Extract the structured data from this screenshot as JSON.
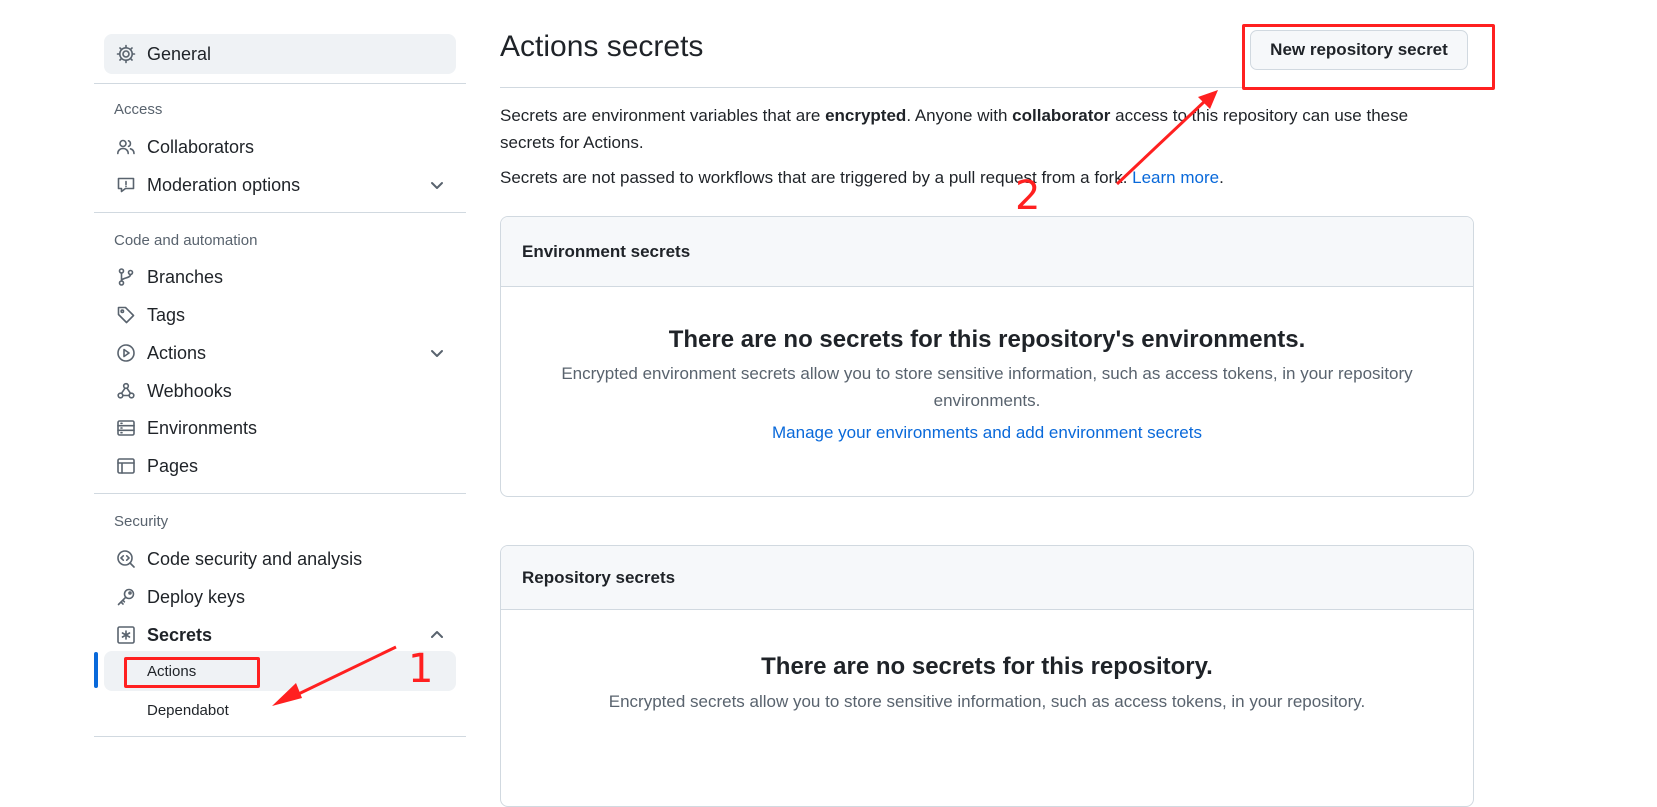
{
  "sidebar": {
    "general": "General",
    "access_heading": "Access",
    "collaborators": "Collaborators",
    "moderation": "Moderation options",
    "code_heading": "Code and automation",
    "branches": "Branches",
    "tags": "Tags",
    "actions": "Actions",
    "webhooks": "Webhooks",
    "environments": "Environments",
    "pages": "Pages",
    "security_heading": "Security",
    "code_security": "Code security and analysis",
    "deploy_keys": "Deploy keys",
    "secrets": "Secrets",
    "secrets_actions": "Actions",
    "secrets_dependabot": "Dependabot"
  },
  "main": {
    "title": "Actions secrets",
    "new_button": "New repository secret",
    "intro_1": "Secrets are environment variables that are ",
    "intro_bold_1": "encrypted",
    "intro_2": ". Anyone with ",
    "intro_bold_2": "collaborator",
    "intro_3": " access to this repository can use these secrets for Actions.",
    "fork_note": "Secrets are not passed to workflows that are triggered by a pull request from a fork. ",
    "learn_more": "Learn more",
    "period": ".",
    "env_box": {
      "header": "Environment secrets",
      "blank_title": "There are no secrets for this repository's environments.",
      "blank_desc": "Encrypted environment secrets allow you to store sensitive information, such as access tokens, in your repository environments.",
      "link": "Manage your environments and add environment secrets"
    },
    "repo_box": {
      "header": "Repository secrets",
      "blank_title": "There are no secrets for this repository.",
      "blank_desc": "Encrypted secrets allow you to store sensitive information, such as access tokens, in your repository."
    }
  },
  "annotations": {
    "step_1": "1",
    "step_2": "2",
    "color": "#ff2020"
  },
  "colors": {
    "accent": "#0969da",
    "border": "#d1d9e0",
    "muted_text": "#59636e",
    "subtle_bg": "#f6f8fa"
  }
}
